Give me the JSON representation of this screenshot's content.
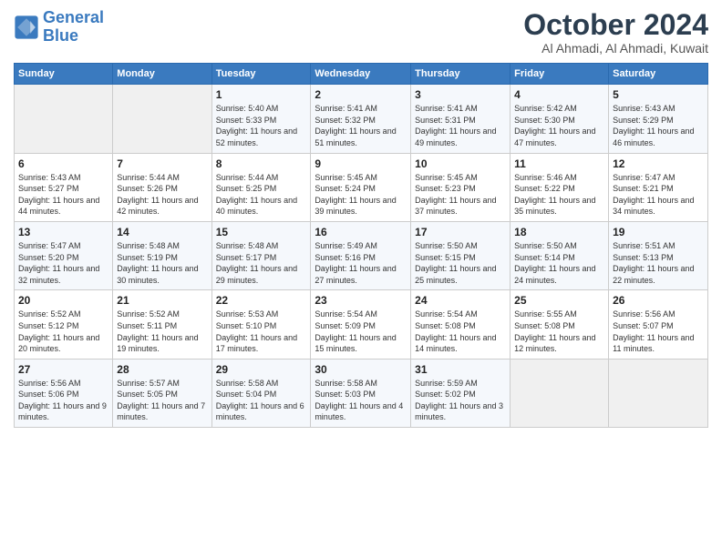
{
  "logo": {
    "line1": "General",
    "line2": "Blue"
  },
  "title": "October 2024",
  "subtitle": "Al Ahmadi, Al Ahmadi, Kuwait",
  "weekdays": [
    "Sunday",
    "Monday",
    "Tuesday",
    "Wednesday",
    "Thursday",
    "Friday",
    "Saturday"
  ],
  "weeks": [
    [
      {
        "day": "",
        "sunrise": "",
        "sunset": "",
        "daylight": ""
      },
      {
        "day": "",
        "sunrise": "",
        "sunset": "",
        "daylight": ""
      },
      {
        "day": "1",
        "sunrise": "Sunrise: 5:40 AM",
        "sunset": "Sunset: 5:33 PM",
        "daylight": "Daylight: 11 hours and 52 minutes."
      },
      {
        "day": "2",
        "sunrise": "Sunrise: 5:41 AM",
        "sunset": "Sunset: 5:32 PM",
        "daylight": "Daylight: 11 hours and 51 minutes."
      },
      {
        "day": "3",
        "sunrise": "Sunrise: 5:41 AM",
        "sunset": "Sunset: 5:31 PM",
        "daylight": "Daylight: 11 hours and 49 minutes."
      },
      {
        "day": "4",
        "sunrise": "Sunrise: 5:42 AM",
        "sunset": "Sunset: 5:30 PM",
        "daylight": "Daylight: 11 hours and 47 minutes."
      },
      {
        "day": "5",
        "sunrise": "Sunrise: 5:43 AM",
        "sunset": "Sunset: 5:29 PM",
        "daylight": "Daylight: 11 hours and 46 minutes."
      }
    ],
    [
      {
        "day": "6",
        "sunrise": "Sunrise: 5:43 AM",
        "sunset": "Sunset: 5:27 PM",
        "daylight": "Daylight: 11 hours and 44 minutes."
      },
      {
        "day": "7",
        "sunrise": "Sunrise: 5:44 AM",
        "sunset": "Sunset: 5:26 PM",
        "daylight": "Daylight: 11 hours and 42 minutes."
      },
      {
        "day": "8",
        "sunrise": "Sunrise: 5:44 AM",
        "sunset": "Sunset: 5:25 PM",
        "daylight": "Daylight: 11 hours and 40 minutes."
      },
      {
        "day": "9",
        "sunrise": "Sunrise: 5:45 AM",
        "sunset": "Sunset: 5:24 PM",
        "daylight": "Daylight: 11 hours and 39 minutes."
      },
      {
        "day": "10",
        "sunrise": "Sunrise: 5:45 AM",
        "sunset": "Sunset: 5:23 PM",
        "daylight": "Daylight: 11 hours and 37 minutes."
      },
      {
        "day": "11",
        "sunrise": "Sunrise: 5:46 AM",
        "sunset": "Sunset: 5:22 PM",
        "daylight": "Daylight: 11 hours and 35 minutes."
      },
      {
        "day": "12",
        "sunrise": "Sunrise: 5:47 AM",
        "sunset": "Sunset: 5:21 PM",
        "daylight": "Daylight: 11 hours and 34 minutes."
      }
    ],
    [
      {
        "day": "13",
        "sunrise": "Sunrise: 5:47 AM",
        "sunset": "Sunset: 5:20 PM",
        "daylight": "Daylight: 11 hours and 32 minutes."
      },
      {
        "day": "14",
        "sunrise": "Sunrise: 5:48 AM",
        "sunset": "Sunset: 5:19 PM",
        "daylight": "Daylight: 11 hours and 30 minutes."
      },
      {
        "day": "15",
        "sunrise": "Sunrise: 5:48 AM",
        "sunset": "Sunset: 5:17 PM",
        "daylight": "Daylight: 11 hours and 29 minutes."
      },
      {
        "day": "16",
        "sunrise": "Sunrise: 5:49 AM",
        "sunset": "Sunset: 5:16 PM",
        "daylight": "Daylight: 11 hours and 27 minutes."
      },
      {
        "day": "17",
        "sunrise": "Sunrise: 5:50 AM",
        "sunset": "Sunset: 5:15 PM",
        "daylight": "Daylight: 11 hours and 25 minutes."
      },
      {
        "day": "18",
        "sunrise": "Sunrise: 5:50 AM",
        "sunset": "Sunset: 5:14 PM",
        "daylight": "Daylight: 11 hours and 24 minutes."
      },
      {
        "day": "19",
        "sunrise": "Sunrise: 5:51 AM",
        "sunset": "Sunset: 5:13 PM",
        "daylight": "Daylight: 11 hours and 22 minutes."
      }
    ],
    [
      {
        "day": "20",
        "sunrise": "Sunrise: 5:52 AM",
        "sunset": "Sunset: 5:12 PM",
        "daylight": "Daylight: 11 hours and 20 minutes."
      },
      {
        "day": "21",
        "sunrise": "Sunrise: 5:52 AM",
        "sunset": "Sunset: 5:11 PM",
        "daylight": "Daylight: 11 hours and 19 minutes."
      },
      {
        "day": "22",
        "sunrise": "Sunrise: 5:53 AM",
        "sunset": "Sunset: 5:10 PM",
        "daylight": "Daylight: 11 hours and 17 minutes."
      },
      {
        "day": "23",
        "sunrise": "Sunrise: 5:54 AM",
        "sunset": "Sunset: 5:09 PM",
        "daylight": "Daylight: 11 hours and 15 minutes."
      },
      {
        "day": "24",
        "sunrise": "Sunrise: 5:54 AM",
        "sunset": "Sunset: 5:08 PM",
        "daylight": "Daylight: 11 hours and 14 minutes."
      },
      {
        "day": "25",
        "sunrise": "Sunrise: 5:55 AM",
        "sunset": "Sunset: 5:08 PM",
        "daylight": "Daylight: 11 hours and 12 minutes."
      },
      {
        "day": "26",
        "sunrise": "Sunrise: 5:56 AM",
        "sunset": "Sunset: 5:07 PM",
        "daylight": "Daylight: 11 hours and 11 minutes."
      }
    ],
    [
      {
        "day": "27",
        "sunrise": "Sunrise: 5:56 AM",
        "sunset": "Sunset: 5:06 PM",
        "daylight": "Daylight: 11 hours and 9 minutes."
      },
      {
        "day": "28",
        "sunrise": "Sunrise: 5:57 AM",
        "sunset": "Sunset: 5:05 PM",
        "daylight": "Daylight: 11 hours and 7 minutes."
      },
      {
        "day": "29",
        "sunrise": "Sunrise: 5:58 AM",
        "sunset": "Sunset: 5:04 PM",
        "daylight": "Daylight: 11 hours and 6 minutes."
      },
      {
        "day": "30",
        "sunrise": "Sunrise: 5:58 AM",
        "sunset": "Sunset: 5:03 PM",
        "daylight": "Daylight: 11 hours and 4 minutes."
      },
      {
        "day": "31",
        "sunrise": "Sunrise: 5:59 AM",
        "sunset": "Sunset: 5:02 PM",
        "daylight": "Daylight: 11 hours and 3 minutes."
      },
      {
        "day": "",
        "sunrise": "",
        "sunset": "",
        "daylight": ""
      },
      {
        "day": "",
        "sunrise": "",
        "sunset": "",
        "daylight": ""
      }
    ]
  ]
}
